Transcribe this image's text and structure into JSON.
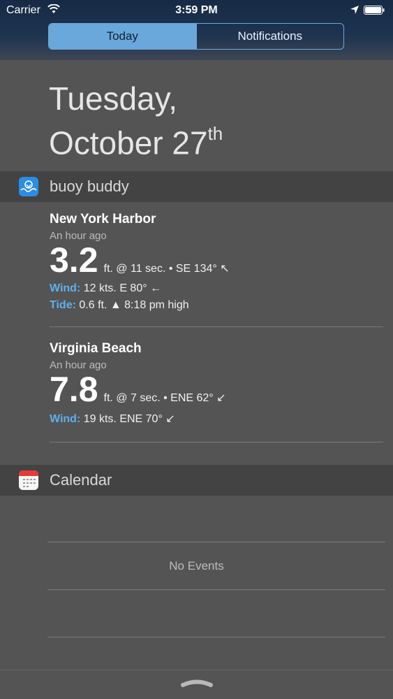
{
  "status_bar": {
    "carrier": "Carrier",
    "time": "3:59 PM"
  },
  "segments": {
    "today": "Today",
    "notifications": "Notifications"
  },
  "date": {
    "weekday": "Tuesday,",
    "month_day": "October 27",
    "suffix": "th"
  },
  "buoy_widget": {
    "app_name": "buoy buddy",
    "icon": "buoy-buddy-icon",
    "entries": [
      {
        "location": "New York Harbor",
        "time": "An hour ago",
        "height": "3.2",
        "swell": "ft. @ 11 sec. • SE 134° ↖",
        "wind_label": "Wind:",
        "wind": "12 kts. E 80° ←",
        "tide_label": "Tide:",
        "tide": "0.6 ft. ▲ 8:18 pm high"
      },
      {
        "location": "Virginia Beach",
        "time": "An hour ago",
        "height": "7.8",
        "swell": "ft. @ 7 sec. • ENE 62° ↙",
        "wind_label": "Wind:",
        "wind": "19 kts. ENE 70° ↙"
      }
    ]
  },
  "calendar_widget": {
    "app_name": "Calendar",
    "icon": "calendar-icon",
    "empty_text": "No Events"
  },
  "colors": {
    "accent_blue": "#6aa7db",
    "label_blue": "#5db0ec",
    "background": "#545454"
  }
}
